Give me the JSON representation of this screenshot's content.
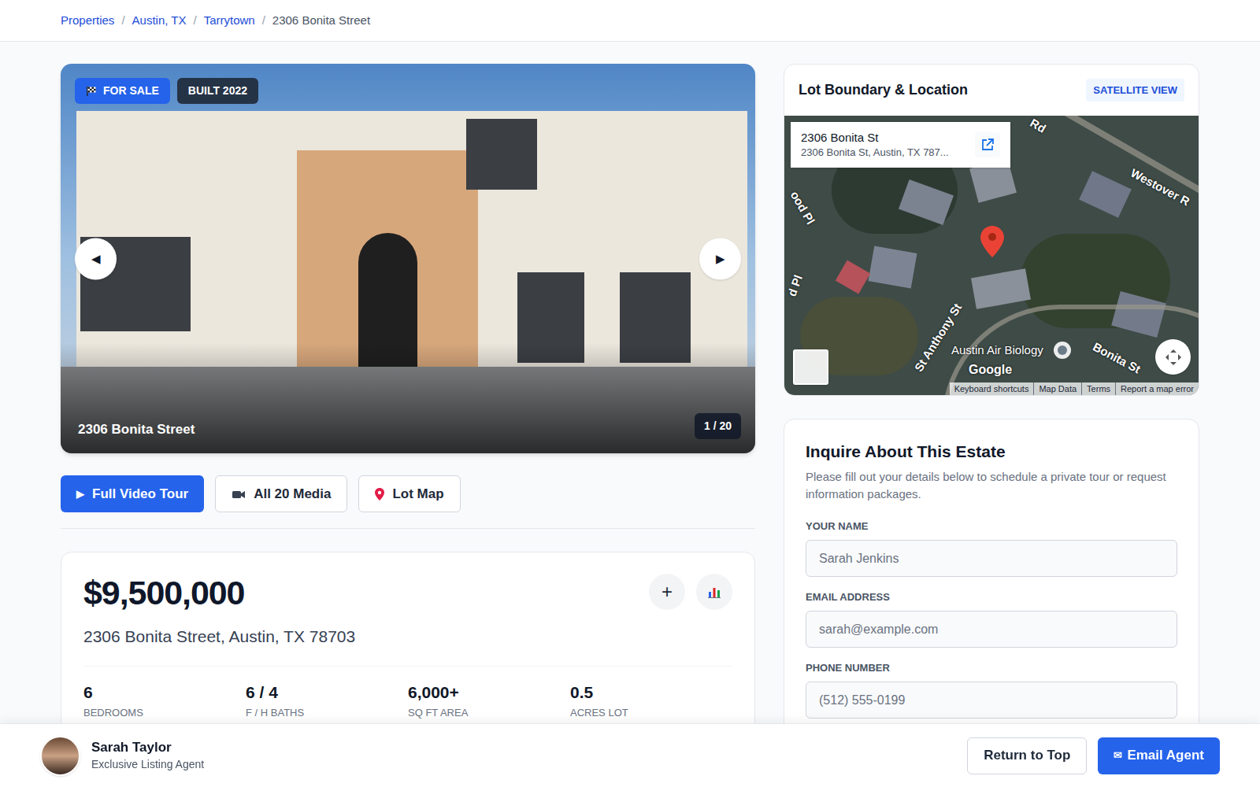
{
  "breadcrumb": {
    "separator": "/",
    "items": [
      {
        "label": "Properties",
        "link": true
      },
      {
        "label": "Austin, TX",
        "link": true
      },
      {
        "label": "Tarrytown",
        "link": true
      },
      {
        "label": "2306 Bonita Street",
        "link": false
      }
    ]
  },
  "gallery": {
    "badges": [
      {
        "label": "FOR SALE",
        "kind": "status"
      },
      {
        "label": "BUILT 2022",
        "kind": "info"
      }
    ],
    "prev": "◀",
    "next": "▶",
    "caption": "2306 Bonita Street",
    "counter": "1 / 20"
  },
  "media_buttons": [
    {
      "kind": "glyph",
      "icon": "▶",
      "label": "Full Video Tour",
      "primary": true
    },
    {
      "kind": "camera",
      "label": "All 20 Media",
      "primary": false
    },
    {
      "kind": "pin",
      "label": "Lot Map",
      "primary": false
    }
  ],
  "listing": {
    "price": "$9,500,000",
    "address": "2306 Bonita Street, Austin, TX 78703",
    "add_icon": "+",
    "stats": [
      {
        "value": "6",
        "label": "BEDROOMS"
      },
      {
        "value": "6 / 4",
        "label": "F / H BATHS"
      },
      {
        "value": "6,000+",
        "label": "SQ FT AREA"
      },
      {
        "value": "0.5",
        "label": "ACRES LOT"
      }
    ]
  },
  "map": {
    "title": "Lot Boundary & Location",
    "view_badge": "SATELLITE VIEW",
    "place": {
      "name": "2306 Bonita St",
      "address": "2306 Bonita St, Austin, TX 787..."
    },
    "labels": [
      "Rd",
      "Westover R",
      "ood Pl",
      "d Pl",
      "St Anthony St",
      "Austin Air Biology",
      "Bonita St"
    ],
    "logo": "Google",
    "attribution": [
      "Keyboard shortcuts",
      "Map Data",
      "Terms",
      "Report a map error"
    ]
  },
  "inquiry": {
    "title": "Inquire About This Estate",
    "description": "Please fill out your details below to schedule a private tour or request information packages.",
    "fields": [
      {
        "label": "YOUR NAME",
        "placeholder": "Sarah Jenkins"
      },
      {
        "label": "EMAIL ADDRESS",
        "placeholder": "sarah@example.com"
      },
      {
        "label": "PHONE NUMBER",
        "placeholder": "(512) 555-0199"
      }
    ]
  },
  "agent": {
    "name": "Sarah Taylor",
    "role": "Exclusive Listing Agent"
  },
  "footer_buttons": [
    {
      "label": "Return to Top",
      "primary": false
    },
    {
      "icon": "✉",
      "label": "Email Agent",
      "primary": true
    }
  ]
}
